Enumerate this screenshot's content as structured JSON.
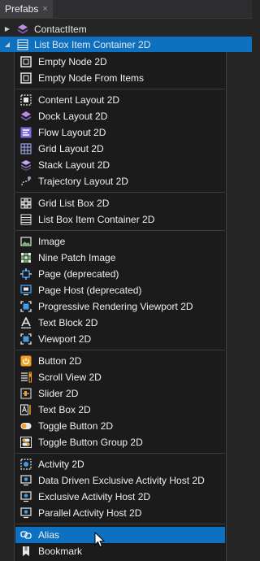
{
  "tab": {
    "title": "Prefabs",
    "close_glyph": "×"
  },
  "tree": {
    "rows": [
      {
        "label": "ContactItem",
        "icon": "prefab-icon",
        "expanded": false,
        "selected": false
      },
      {
        "label": "List Box Item Container 2D",
        "icon": "list-box-item-container-icon",
        "expanded": true,
        "selected": true
      }
    ]
  },
  "menu": {
    "groups": [
      {
        "items": [
          {
            "label": "Empty Node 2D",
            "icon": "empty-node-icon"
          },
          {
            "label": "Empty Node From Items",
            "icon": "empty-node-icon"
          }
        ]
      },
      {
        "items": [
          {
            "label": "Content Layout 2D",
            "icon": "content-layout-icon"
          },
          {
            "label": "Dock Layout 2D",
            "icon": "dock-layout-icon"
          },
          {
            "label": "Flow Layout 2D",
            "icon": "flow-layout-icon"
          },
          {
            "label": "Grid Layout 2D",
            "icon": "grid-layout-icon"
          },
          {
            "label": "Stack Layout 2D",
            "icon": "stack-layout-icon"
          },
          {
            "label": "Trajectory Layout 2D",
            "icon": "trajectory-layout-icon"
          }
        ]
      },
      {
        "items": [
          {
            "label": "Grid List Box 2D",
            "icon": "grid-list-box-icon"
          },
          {
            "label": "List Box Item Container 2D",
            "icon": "list-box-item-container-icon"
          }
        ]
      },
      {
        "items": [
          {
            "label": "Image",
            "icon": "image-icon"
          },
          {
            "label": "Nine Patch Image",
            "icon": "nine-patch-image-icon"
          },
          {
            "label": "Page (deprecated)",
            "icon": "page-icon"
          },
          {
            "label": "Page Host (deprecated)",
            "icon": "page-host-icon"
          },
          {
            "label": "Progressive Rendering Viewport 2D",
            "icon": "viewport-icon"
          },
          {
            "label": "Text Block 2D",
            "icon": "text-block-icon"
          },
          {
            "label": "Viewport 2D",
            "icon": "viewport-icon"
          }
        ]
      },
      {
        "items": [
          {
            "label": "Button 2D",
            "icon": "button-icon"
          },
          {
            "label": "Scroll View 2D",
            "icon": "scroll-view-icon"
          },
          {
            "label": "Slider 2D",
            "icon": "slider-icon"
          },
          {
            "label": "Text Box 2D",
            "icon": "text-box-icon"
          },
          {
            "label": "Toggle Button 2D",
            "icon": "toggle-button-icon"
          },
          {
            "label": "Toggle Button Group 2D",
            "icon": "toggle-button-group-icon"
          }
        ]
      },
      {
        "items": [
          {
            "label": "Activity 2D",
            "icon": "activity-icon"
          },
          {
            "label": "Data Driven Exclusive Activity Host 2D",
            "icon": "activity-host-icon"
          },
          {
            "label": "Exclusive Activity Host 2D",
            "icon": "activity-host-icon"
          },
          {
            "label": "Parallel Activity Host 2D",
            "icon": "activity-host-icon"
          }
        ]
      },
      {
        "items": [
          {
            "label": "Alias",
            "icon": "alias-icon",
            "highlighted": true
          },
          {
            "label": "Bookmark",
            "icon": "bookmark-icon"
          }
        ]
      }
    ]
  },
  "colors": {
    "background": "#252526",
    "menu_background": "#1b1b1c",
    "selection": "#0e70c0",
    "icon_blue": "#3d9be9",
    "icon_orange": "#f0a020"
  }
}
